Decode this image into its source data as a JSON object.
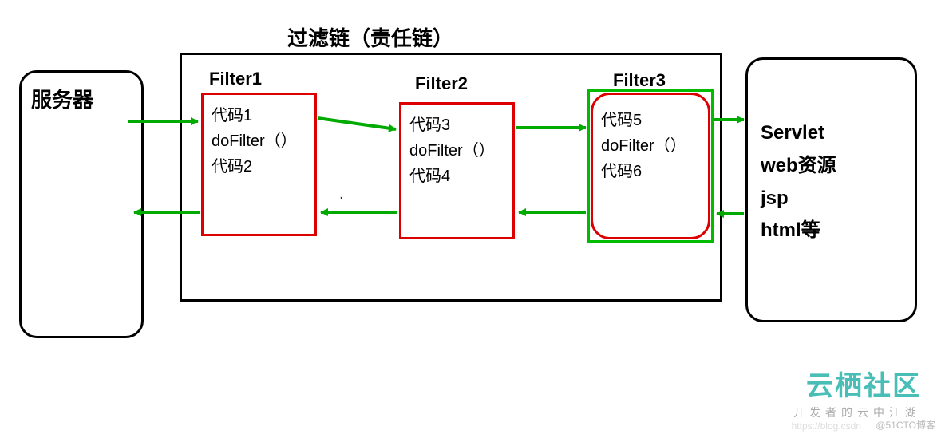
{
  "title": "过滤链（责任链）",
  "server_label": "服务器",
  "filters": [
    {
      "name": "Filter1",
      "code_before": "代码1",
      "method": "doFilter（）",
      "code_after": "代码2"
    },
    {
      "name": "Filter2",
      "code_before": "代码3",
      "method": "doFilter（）",
      "code_after": "代码4"
    },
    {
      "name": "Filter3",
      "code_before": "代码5",
      "method": "doFilter（）",
      "code_after": "代码6"
    }
  ],
  "resource": {
    "line1": "Servlet",
    "line2": "web资源",
    "line3": "jsp",
    "line4": "html等"
  },
  "logo": {
    "main": "云栖社区",
    "sub": "开发者的云中江湖"
  },
  "watermark_left": "https://blog.csdn",
  "watermark": "@51CTO博客",
  "chart_data": {
    "type": "flow-diagram",
    "title": "过滤链（责任链）",
    "nodes": [
      {
        "id": "server",
        "label": "服务器",
        "type": "endpoint"
      },
      {
        "id": "filter1",
        "label": "Filter1",
        "type": "filter",
        "body": [
          "代码1",
          "doFilter（）",
          "代码2"
        ]
      },
      {
        "id": "filter2",
        "label": "Filter2",
        "type": "filter",
        "body": [
          "代码3",
          "doFilter（）",
          "代码4"
        ]
      },
      {
        "id": "filter3",
        "label": "Filter3",
        "type": "filter",
        "body": [
          "代码5",
          "doFilter（）",
          "代码6"
        ]
      },
      {
        "id": "resource",
        "label": "Servlet / web资源 / jsp / html等",
        "type": "endpoint"
      }
    ],
    "edges_forward": [
      {
        "from": "server",
        "to": "filter1"
      },
      {
        "from": "filter1",
        "to": "filter2"
      },
      {
        "from": "filter2",
        "to": "filter3"
      },
      {
        "from": "filter3",
        "to": "resource"
      }
    ],
    "edges_return": [
      {
        "from": "resource",
        "to": "filter3"
      },
      {
        "from": "filter3",
        "to": "filter2"
      },
      {
        "from": "filter2",
        "to": "filter1"
      },
      {
        "from": "filter1",
        "to": "server"
      }
    ],
    "arrow_color": "#00aa00",
    "filter_border_color": "#dd0000"
  }
}
